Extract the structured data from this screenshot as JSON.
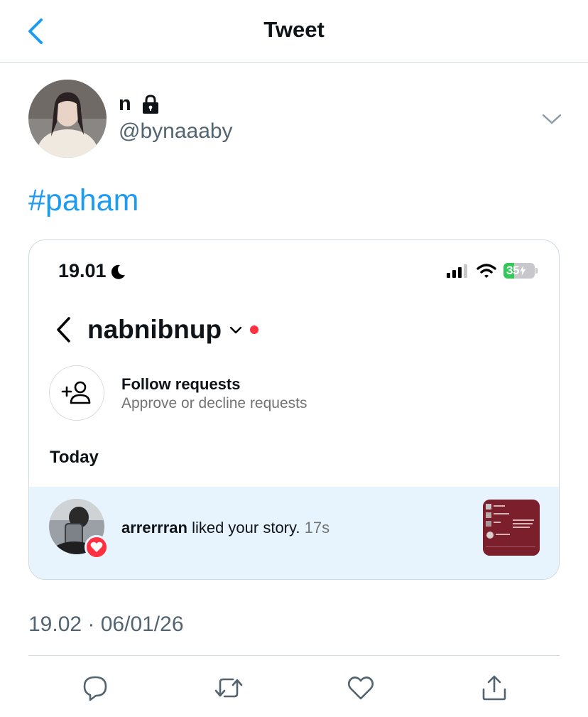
{
  "header": {
    "title": "Tweet"
  },
  "author": {
    "display_name": "n",
    "handle": "@bynaaaby"
  },
  "tweet": {
    "text": "#paham",
    "timestamp": "19.02 · 06/01/26"
  },
  "embedded_screenshot": {
    "status_bar": {
      "time": "19.01",
      "battery": "35"
    },
    "username": "nabnibnup",
    "follow_requests": {
      "title": "Follow requests",
      "subtitle": "Approve or decline requests"
    },
    "section_label": "Today",
    "notification": {
      "user": "arrerrran",
      "action": " liked your story.",
      "time": "17s"
    }
  },
  "colors": {
    "accent": "#1d9bf0",
    "secondary_text": "#536471",
    "notification_bg": "#e8f4fd",
    "ig_red": "#ff3040"
  },
  "icons": [
    "back-chevron-icon",
    "lock-icon",
    "chevron-down-icon",
    "moon-icon",
    "signal-icon",
    "wifi-icon",
    "battery-icon",
    "add-person-icon",
    "heart-icon",
    "reply-icon",
    "retweet-icon",
    "like-icon",
    "share-icon"
  ]
}
